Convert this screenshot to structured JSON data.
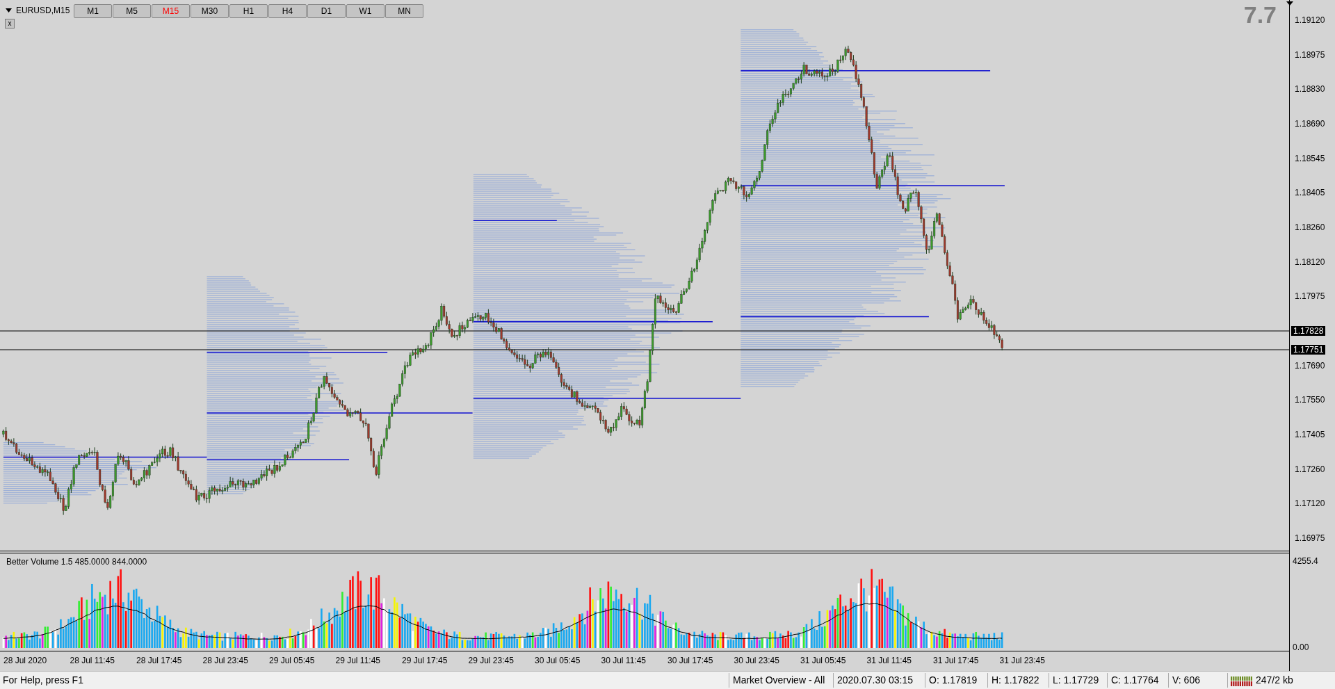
{
  "chart": {
    "symbol": "EURUSD,M15",
    "close_button": "x",
    "timeframes": [
      {
        "label": "M1",
        "selected": false
      },
      {
        "label": "M5",
        "selected": false
      },
      {
        "label": "M15",
        "selected": true
      },
      {
        "label": "M30",
        "selected": false
      },
      {
        "label": "H1",
        "selected": false
      },
      {
        "label": "H4",
        "selected": false
      },
      {
        "label": "D1",
        "selected": false
      },
      {
        "label": "W1",
        "selected": false
      },
      {
        "label": "MN",
        "selected": false
      }
    ],
    "corner_value": "7.7",
    "price_axis": [
      "1.19120",
      "1.18975",
      "1.18830",
      "1.18690",
      "1.18545",
      "1.18405",
      "1.18260",
      "1.18120",
      "1.17975",
      "1.17690",
      "1.17550",
      "1.17405",
      "1.17260",
      "1.17120",
      "1.16975"
    ],
    "price_tags": [
      "1.17828",
      "1.17751"
    ],
    "time_axis": [
      "28 Jul 2020",
      "28 Jul 11:45",
      "28 Jul 17:45",
      "28 Jul 23:45",
      "29 Jul 05:45",
      "29 Jul 11:45",
      "29 Jul 17:45",
      "29 Jul 23:45",
      "30 Jul 05:45",
      "30 Jul 11:45",
      "30 Jul 17:45",
      "30 Jul 23:45",
      "31 Jul 05:45",
      "31 Jul 11:45",
      "31 Jul 17:45",
      "31 Jul 23:45"
    ]
  },
  "indicator": {
    "title": "Better Volume 1.5 485.0000 844.0000",
    "axis": [
      "4255.4",
      "0.00"
    ]
  },
  "status_bar": {
    "help": "For Help, press F1",
    "cells": [
      "Market Overview - All",
      "2020.07.30 03:15",
      "O: 1.17819",
      "H: 1.17822",
      "L: 1.17729",
      "C: 1.17764",
      "V: 606"
    ],
    "traffic": "247/2 kb"
  }
}
